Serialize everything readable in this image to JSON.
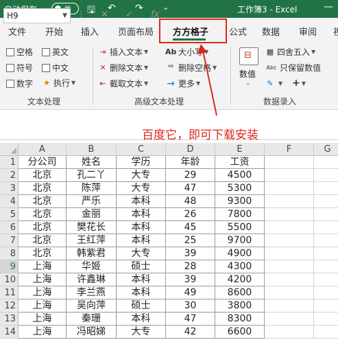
{
  "titlebar": {
    "autosave_label": "自动保存",
    "toggle_label": "关",
    "workbook_title": "工作簿3 - Excel",
    "min_label": "—"
  },
  "tabs": [
    "文件",
    "开始",
    "插入",
    "页面布局",
    "方方格子",
    "公式",
    "数据",
    "审阅",
    "视"
  ],
  "active_tab": "方方格子",
  "ribbon": {
    "checkboxes": [
      "空格",
      "英文",
      "符号",
      "中文",
      "数字"
    ],
    "execute_label": "执行",
    "insert_text": "插入文本",
    "delete_text": "删除文本",
    "cut_text": "截取文本",
    "case_label": "大小写",
    "delete_space": "删除空格",
    "more_label": "更多",
    "numeric_label": "数值",
    "round_label": "四舍五入",
    "keep_numeric": "只保留数值",
    "group_text_processing": "文本处理",
    "group_advanced_text": "高级文本处理",
    "group_data_entry": "数据录入",
    "ab_glyph": "Ab",
    "abc_glyph": "Abc"
  },
  "formula_bar": {
    "name_box": "H9",
    "fx_label": "fx"
  },
  "annotation": "百度它，即可下载安装",
  "columns": [
    "A",
    "B",
    "C",
    "D",
    "E",
    "F",
    "G"
  ],
  "rows": [
    "1",
    "2",
    "3",
    "4",
    "5",
    "6",
    "7",
    "8",
    "9",
    "10",
    "11",
    "12",
    "13",
    "14"
  ],
  "selected_row": "9",
  "table": [
    [
      "分公司",
      "姓名",
      "学历",
      "年龄",
      "工资"
    ],
    [
      "北京",
      "孔二丫",
      "大专",
      "29",
      "4500"
    ],
    [
      "北京",
      "陈萍",
      "大专",
      "47",
      "5300"
    ],
    [
      "北京",
      "严乐",
      "本科",
      "48",
      "9300"
    ],
    [
      "北京",
      "金丽",
      "本科",
      "26",
      "7800"
    ],
    [
      "北京",
      "樊花长",
      "本科",
      "45",
      "5500"
    ],
    [
      "北京",
      "王红萍",
      "本科",
      "25",
      "9700"
    ],
    [
      "北京",
      "韩紫君",
      "大专",
      "39",
      "4900"
    ],
    [
      "上海",
      "华姬",
      "硕士",
      "28",
      "4300"
    ],
    [
      "上海",
      "许鑫琳",
      "本科",
      "39",
      "4200"
    ],
    [
      "上海",
      "李兰燕",
      "本科",
      "49",
      "8600"
    ],
    [
      "上海",
      "吴向萍",
      "硕士",
      "30",
      "3800"
    ],
    [
      "上海",
      "秦珊",
      "本科",
      "47",
      "8300"
    ],
    [
      "上海",
      "冯昭娣",
      "大专",
      "42",
      "6600"
    ]
  ],
  "colors": {
    "excel_green": "#217346",
    "annotation_red": "#e0261b"
  }
}
